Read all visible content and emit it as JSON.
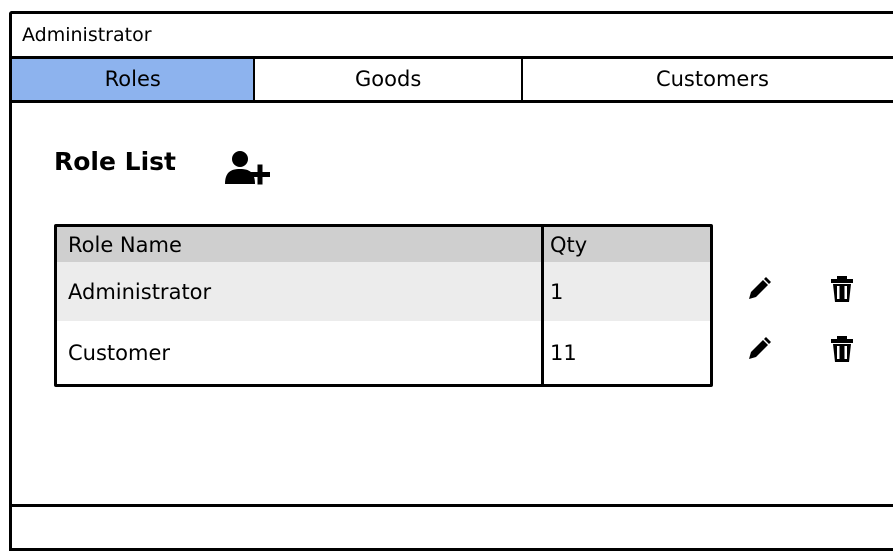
{
  "window": {
    "title": "Administrator"
  },
  "tabs": [
    {
      "label": "Roles",
      "active": true
    },
    {
      "label": "Goods",
      "active": false
    },
    {
      "label": "Customers",
      "active": false
    }
  ],
  "main": {
    "title": "Role List",
    "add_icon": "add-user-icon",
    "table": {
      "columns": [
        "Role Name",
        "Qty"
      ],
      "rows": [
        {
          "name": "Administrator",
          "qty": "1"
        },
        {
          "name": "Customer",
          "qty": "11"
        }
      ],
      "row_actions": [
        "pencil-icon",
        "trash-icon"
      ]
    }
  },
  "colors": {
    "active_tab": "#8db3ee",
    "header_row": "#cfcfcf",
    "alt_row": "#ececec"
  }
}
